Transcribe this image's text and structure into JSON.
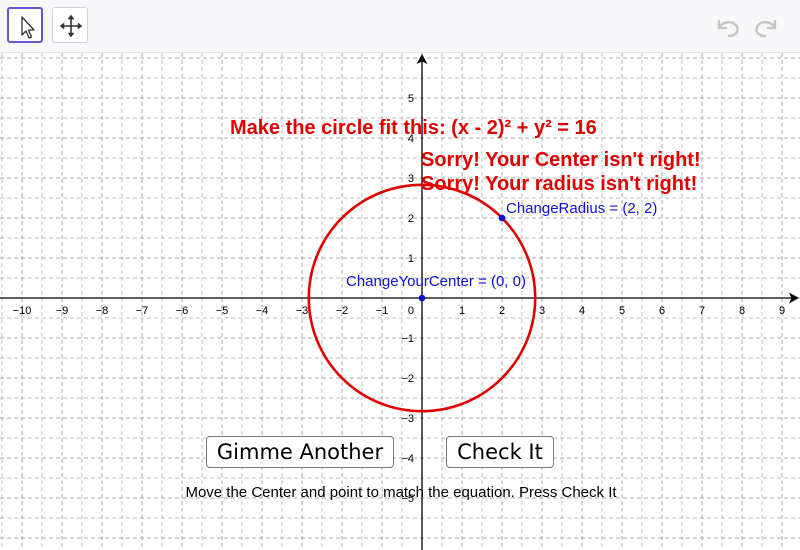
{
  "toolbar": {
    "tools": [
      {
        "name": "move-tool",
        "icon": "cursor-arrow-icon",
        "active": true
      },
      {
        "name": "move-graphics-view-tool",
        "icon": "four-arrows-move-icon",
        "active": false
      }
    ],
    "undo_icon": "undo-arrow-icon",
    "redo_icon": "redo-arrow-icon"
  },
  "graph": {
    "x_ticks": [
      "−10",
      "−9",
      "−8",
      "−7",
      "−6",
      "−5",
      "−4",
      "−3",
      "−2",
      "−1",
      "0",
      "1",
      "2",
      "3",
      "4",
      "5",
      "6",
      "7",
      "8",
      "9"
    ],
    "y_ticks": [
      "5",
      "4",
      "3",
      "2",
      "1",
      "−1",
      "−2",
      "−3",
      "−4",
      "−5"
    ],
    "y_tick_values": [
      5,
      4,
      3,
      2,
      1,
      -1,
      -2,
      -3,
      -4,
      -5
    ],
    "origin_label": "0",
    "circle": {
      "center": [
        0,
        0
      ],
      "radius": 2.83,
      "color": "#e00000"
    },
    "points": [
      {
        "name": "center-point",
        "label": "ChangeYourCenter = (0, 0)",
        "x": 0,
        "y": 0,
        "color": "#1010d0"
      },
      {
        "name": "radius-point",
        "label": "ChangeRadius = (2, 2)",
        "x": 2,
        "y": 2,
        "color": "#1010d0"
      }
    ]
  },
  "texts": {
    "target_equation": "Make the circle fit this: (x - 2)² + y² = 16",
    "center_feedback": "Sorry! Your Center isn't right!",
    "radius_feedback": "Sorry! Your radius isn't right!",
    "instructions": "Move the Center and point to match the equation. Press Check It"
  },
  "buttons": {
    "gimme_another": "Gimme Another",
    "check_it": "Check It"
  },
  "colors": {
    "feedback": "#e00000",
    "point": "#1010d0",
    "axis": "#000000",
    "grid": "#a8a8a8"
  }
}
